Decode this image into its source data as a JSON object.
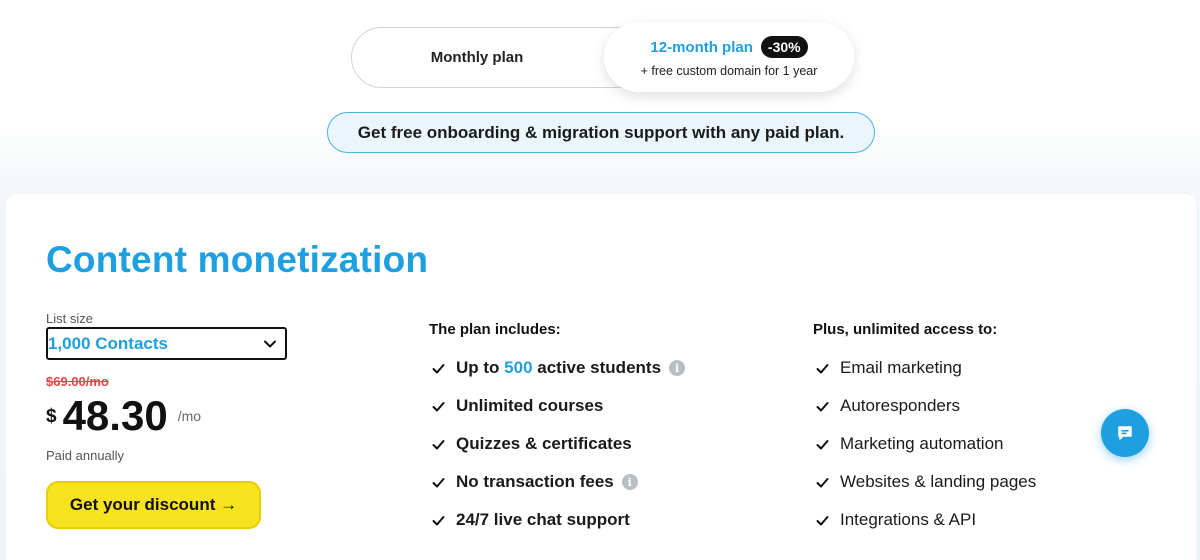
{
  "plan_toggle": {
    "monthly_label": "Monthly plan",
    "annual_label": "12-month plan",
    "annual_discount": "-30%",
    "annual_bonus": "+ free custom domain for 1 year"
  },
  "banner": {
    "text": "Get free onboarding & migration support with any paid plan."
  },
  "card": {
    "title": "Content monetization",
    "list_size_label": "List size",
    "list_size_value": "1,000 Contacts",
    "old_price": "$69.00/mo",
    "currency": "$",
    "price": "48.30",
    "per": "/mo",
    "billing_note": "Paid annually",
    "cta_label": "Get your discount →"
  },
  "plan_includes": {
    "heading": "The plan includes:",
    "students_prefix": "Up to ",
    "students_count": "500",
    "students_suffix": " active students",
    "items": [
      "Unlimited courses",
      "Quizzes & certificates"
    ],
    "fees_label": "No transaction fees",
    "support_label": "24/7 live chat support"
  },
  "unlimited_access": {
    "heading": "Plus, unlimited access to:",
    "items": [
      "Email marketing",
      "Autoresponders",
      "Marketing automation",
      "Websites & landing pages",
      "Integrations & API"
    ]
  },
  "icons": {
    "info": "i",
    "check": "check-icon",
    "chat": "chat-icon",
    "chevron": "chevron-down-icon"
  },
  "colors": {
    "accent": "#1e9fe0",
    "cta": "#f7e21f",
    "strike": "#e64545"
  }
}
